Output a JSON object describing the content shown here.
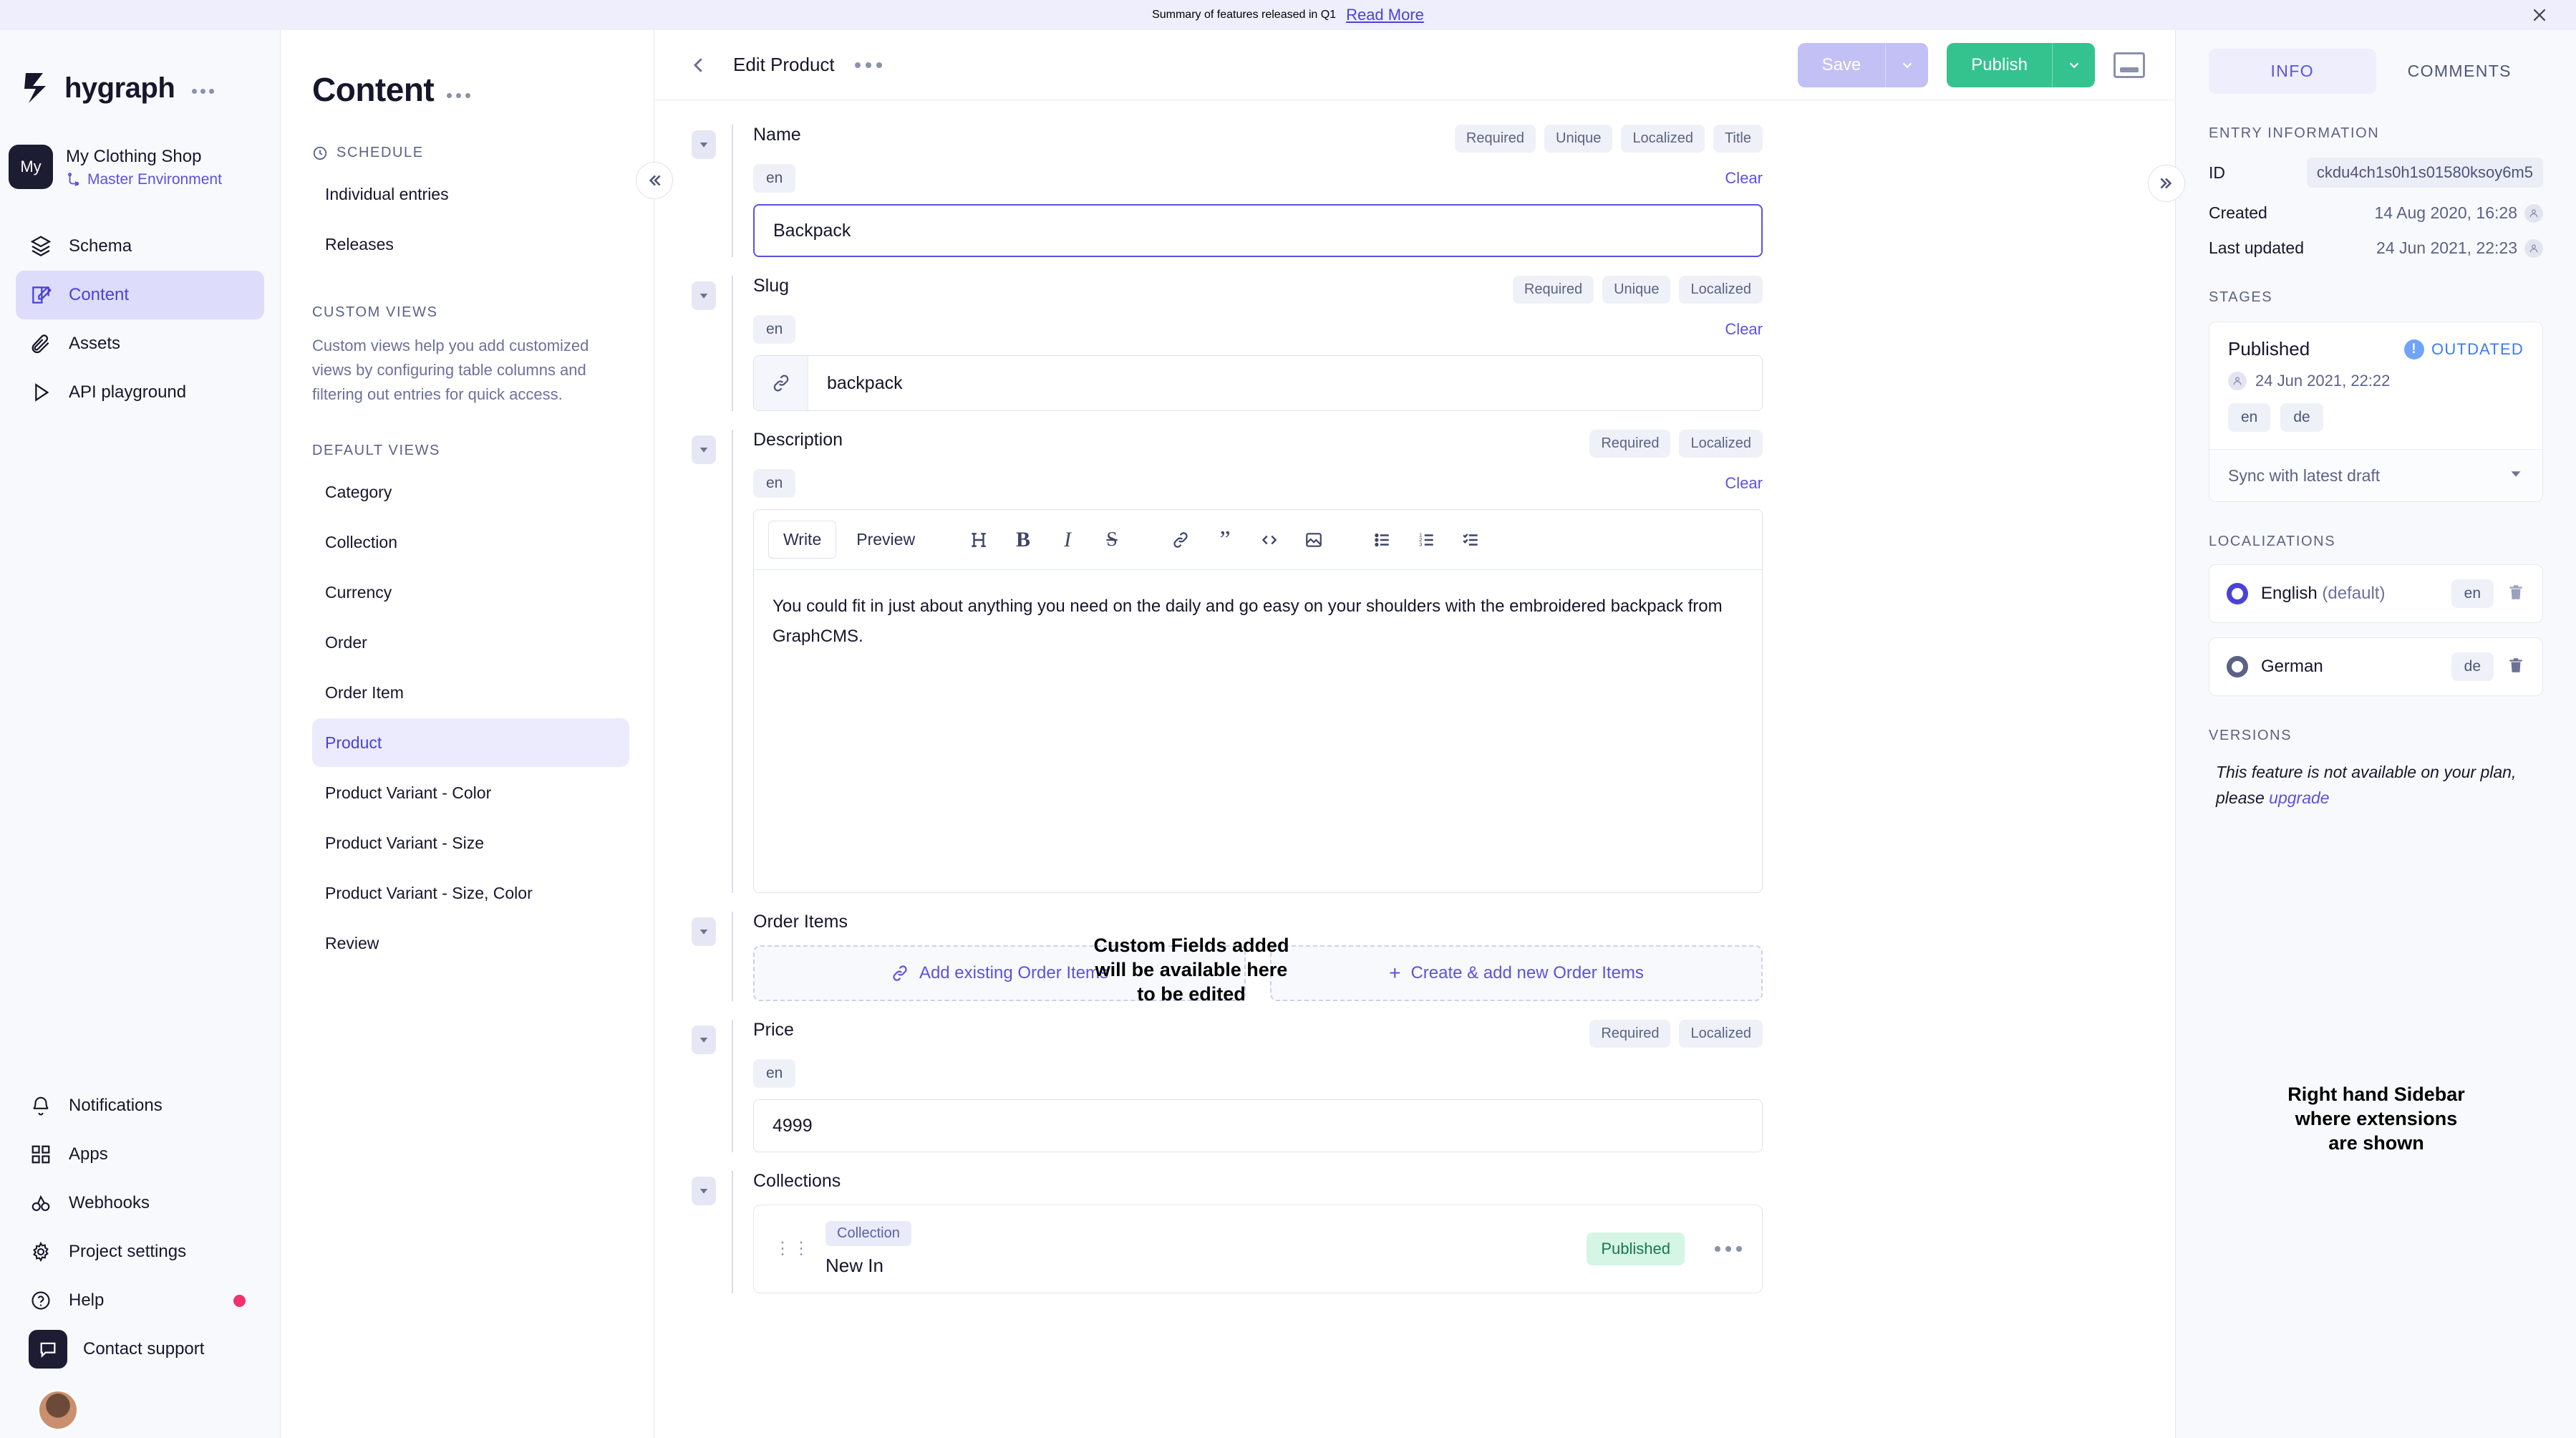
{
  "banner": {
    "text": "Summary of features released in Q1",
    "link": "Read More",
    "close_icon": "close-icon"
  },
  "leftnav": {
    "logo": "hygraph",
    "project": {
      "initials": "My",
      "name": "My Clothing Shop",
      "environment": "Master Environment"
    },
    "items": [
      {
        "label": "Schema",
        "icon": "layers-icon",
        "active": false
      },
      {
        "label": "Content",
        "icon": "edit-square-icon",
        "active": true
      },
      {
        "label": "Assets",
        "icon": "paperclip-icon",
        "active": false
      },
      {
        "label": "API playground",
        "icon": "play-icon",
        "active": false
      }
    ],
    "bottom_items": [
      {
        "label": "Notifications",
        "icon": "bell-icon",
        "dot": false
      },
      {
        "label": "Apps",
        "icon": "grid-icon",
        "dot": false
      },
      {
        "label": "Webhooks",
        "icon": "webhook-icon",
        "dot": false
      },
      {
        "label": "Project settings",
        "icon": "gear-icon",
        "dot": false
      },
      {
        "label": "Help",
        "icon": "question-circle-icon",
        "dot": true
      },
      {
        "label": "Contact support",
        "icon": "chat-icon",
        "dot": false
      }
    ]
  },
  "listpanel": {
    "title": "Content",
    "schedule_header": "SCHEDULE",
    "schedule_items": [
      "Individual entries",
      "Releases"
    ],
    "custom_views_header": "CUSTOM VIEWS",
    "custom_views_desc": "Custom views help you add customized views by configuring table columns and filtering out entries for quick access.",
    "default_views_header": "DEFAULT VIEWS",
    "default_views": [
      {
        "label": "Category",
        "active": false
      },
      {
        "label": "Collection",
        "active": false
      },
      {
        "label": "Currency",
        "active": false
      },
      {
        "label": "Order",
        "active": false
      },
      {
        "label": "Order Item",
        "active": false
      },
      {
        "label": "Product",
        "active": true
      },
      {
        "label": "Product Variant - Color",
        "active": false
      },
      {
        "label": "Product Variant - Size",
        "active": false
      },
      {
        "label": "Product Variant - Size, Color",
        "active": false
      },
      {
        "label": "Review",
        "active": false
      }
    ]
  },
  "editor": {
    "back_icon": "chevron-left-icon",
    "title": "Edit Product",
    "more_icon": "more-dots-icon",
    "save_label": "Save",
    "publish_label": "Publish",
    "sidebar_toggle_icon": "panel-toggle-icon",
    "fields": {
      "name": {
        "label": "Name",
        "pills": [
          "Required",
          "Unique",
          "Localized",
          "Title"
        ],
        "locale": "en",
        "clear": "Clear",
        "value": "Backpack"
      },
      "slug": {
        "label": "Slug",
        "pills": [
          "Required",
          "Unique",
          "Localized"
        ],
        "locale": "en",
        "clear": "Clear",
        "value": "backpack",
        "icon": "link-icon"
      },
      "description": {
        "label": "Description",
        "pills": [
          "Required",
          "Localized"
        ],
        "locale": "en",
        "clear": "Clear",
        "tabs": [
          "Write",
          "Preview"
        ],
        "active_tab": "Write",
        "toolbar_icons": [
          "heading-icon",
          "bold-icon",
          "italic-icon",
          "strikethrough-icon",
          "link-icon",
          "quote-icon",
          "code-icon",
          "image-icon",
          "bullet-list-icon",
          "numbered-list-icon",
          "check-list-icon"
        ],
        "value": "You could fit in just about anything you need on the daily and go easy on your shoulders with the embroidered backpack from GraphCMS."
      },
      "order_items": {
        "label": "Order Items",
        "add_existing": "Add existing Order Items",
        "create_new": "Create & add new Order Items"
      },
      "price": {
        "label": "Price",
        "pills": [
          "Required",
          "Localized"
        ],
        "locale": "en",
        "value": "4999"
      },
      "collections": {
        "label": "Collections",
        "entry": {
          "type_tag": "Collection",
          "title": "New In",
          "status": "Published",
          "more_icon": "more-dots-icon",
          "grip_icon": "drag-handle-icon"
        }
      }
    }
  },
  "annotations": [
    "Custom Fields added\nwill be available here\nto be edited",
    "Right hand Sidebar\nwhere extensions\nare shown"
  ],
  "rightbar": {
    "tabs": [
      {
        "label": "INFO",
        "active": true
      },
      {
        "label": "COMMENTS",
        "active": false
      }
    ],
    "entry_information_header": "ENTRY INFORMATION",
    "rows": [
      {
        "key": "ID",
        "value": "ckdu4ch1s0h1s01580ksoy6m5",
        "chip": true
      },
      {
        "key": "Created",
        "value": "14 Aug 2020, 16:28",
        "chip": false
      },
      {
        "key": "Last updated",
        "value": "24 Jun 2021, 22:23",
        "chip": false
      }
    ],
    "stages_header": "STAGES",
    "stage": {
      "name": "Published",
      "flag": "OUTDATED",
      "date": "24 Jun 2021, 22:22",
      "locales": [
        "en",
        "de"
      ],
      "sync_label": "Sync with latest draft"
    },
    "localizations_header": "LOCALIZATIONS",
    "localizations": [
      {
        "name": "English",
        "suffix": "(default)",
        "code": "en"
      },
      {
        "name": "German",
        "suffix": "",
        "code": "de"
      }
    ],
    "versions_header": "VERSIONS",
    "versions_note_1": "This feature is not available on your plan,",
    "versions_note_2": "please ",
    "versions_link": "upgrade"
  }
}
